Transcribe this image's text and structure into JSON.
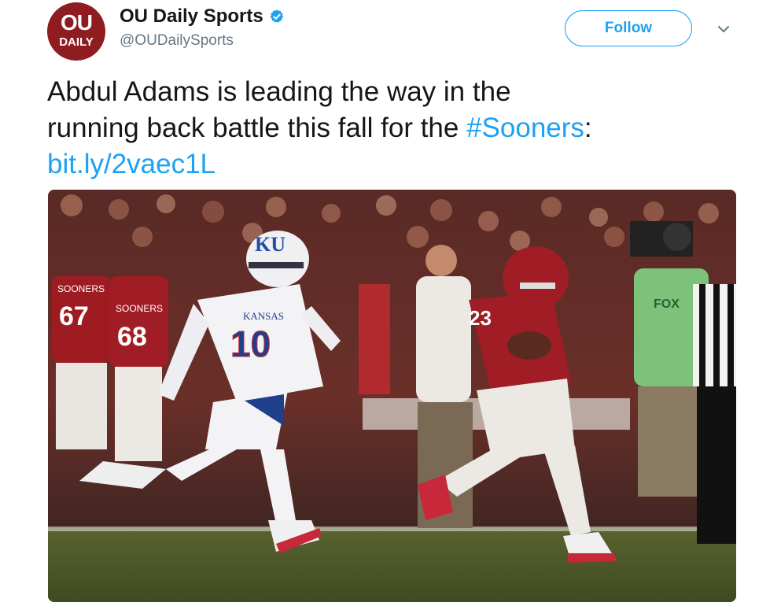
{
  "account": {
    "avatar_line1": "OU",
    "avatar_line2": "DAILY",
    "name": "OU Daily Sports",
    "handle": "@OUDailySports",
    "verified_icon": "verified-badge-icon"
  },
  "actions": {
    "follow_label": "Follow",
    "more_icon": "chevron-down-icon"
  },
  "tweet": {
    "text_line1": "Abdul Adams is leading the way in the",
    "text_line2_prefix": "running back battle this fall for the ",
    "hashtag": "#Sooners",
    "text_line2_suffix": ":",
    "link": "bit.ly/2vaec1L"
  },
  "photo": {
    "jersey_kansas_number": "10",
    "jersey_kansas_text": "KANSAS",
    "helmet_kansas_text": "KU",
    "jersey_ou_number": "23",
    "bench_numbers": [
      "67",
      "68"
    ],
    "bench_jersey_text": "SOONERS",
    "camera_vest_text": "FOX"
  },
  "colors": {
    "accent_blue": "#1da1f2",
    "ou_crimson": "#8e1c21",
    "text_dark": "#14171a",
    "text_gray": "#657786"
  }
}
